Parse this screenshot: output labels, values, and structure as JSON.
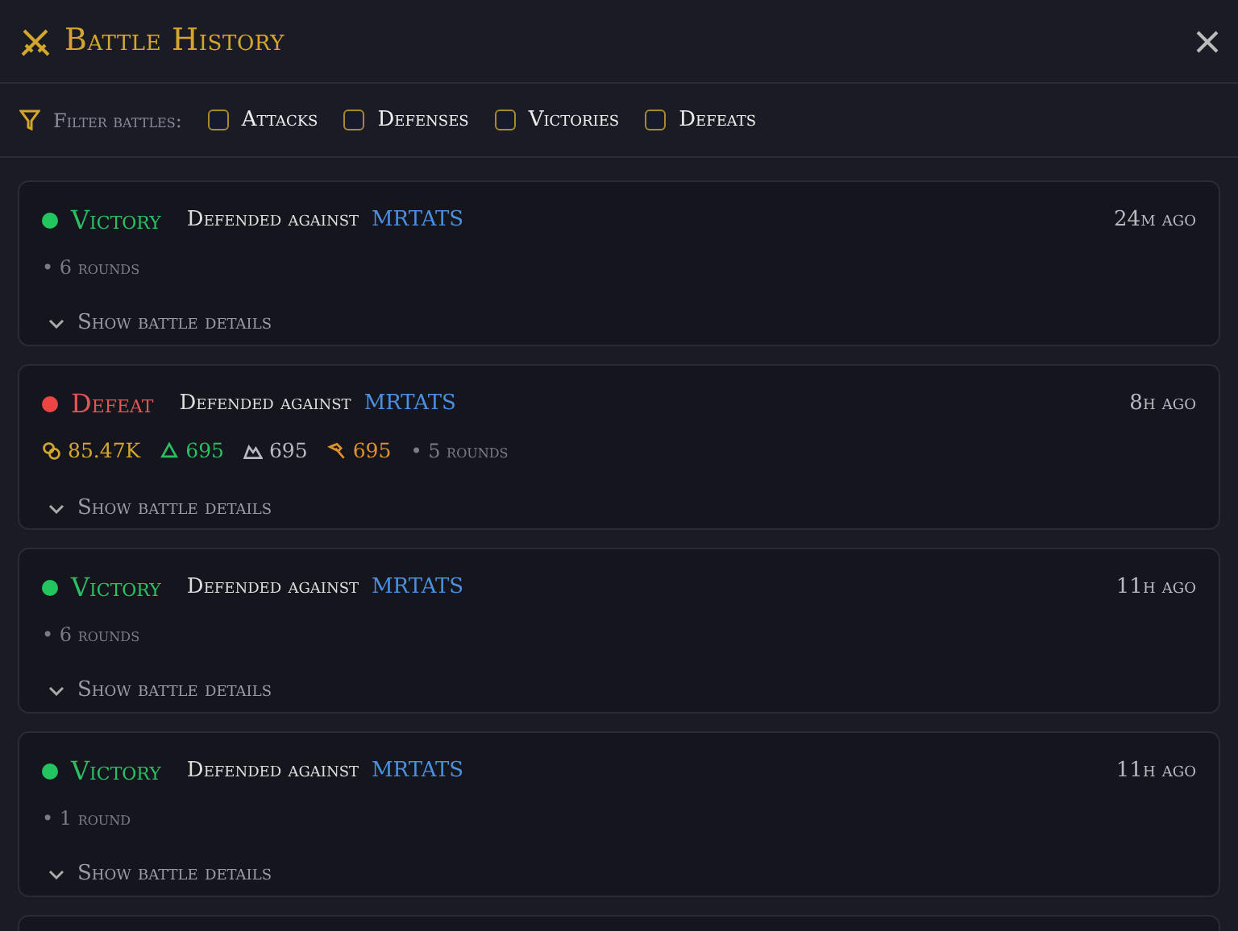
{
  "window": {
    "title": "Battle History"
  },
  "filter": {
    "label": "Filter battles:",
    "options": [
      {
        "label": "Attacks",
        "checked": false
      },
      {
        "label": "Defenses",
        "checked": false
      },
      {
        "label": "Victories",
        "checked": false
      },
      {
        "label": "Defeats",
        "checked": false
      }
    ]
  },
  "battles": [
    {
      "kind": "victory",
      "result": "Victory",
      "action": "Defended against",
      "opponent": "MRTATS",
      "time": "24m ago",
      "rounds": "• 6 rounds",
      "details": "Show battle details"
    },
    {
      "kind": "defeat",
      "result": "Defeat",
      "action": "Defended against",
      "opponent": "MRTATS",
      "time": "8h ago",
      "stats": [
        {
          "kind": "coins",
          "value": "85.47K"
        },
        {
          "kind": "triangle",
          "value": "695"
        },
        {
          "kind": "peak",
          "value": "695"
        },
        {
          "kind": "hammer",
          "value": "695"
        }
      ],
      "rounds": "• 5 rounds",
      "details": "Show battle details"
    },
    {
      "kind": "victory",
      "result": "Victory",
      "action": "Defended against",
      "opponent": "MRTATS",
      "time": "11h ago",
      "rounds": "• 6 rounds",
      "details": "Show battle details"
    },
    {
      "kind": "victory",
      "result": "Victory",
      "action": "Defended against",
      "opponent": "MRTATS",
      "time": "11h ago",
      "rounds": "• 1 round",
      "details": "Show battle details"
    }
  ]
}
